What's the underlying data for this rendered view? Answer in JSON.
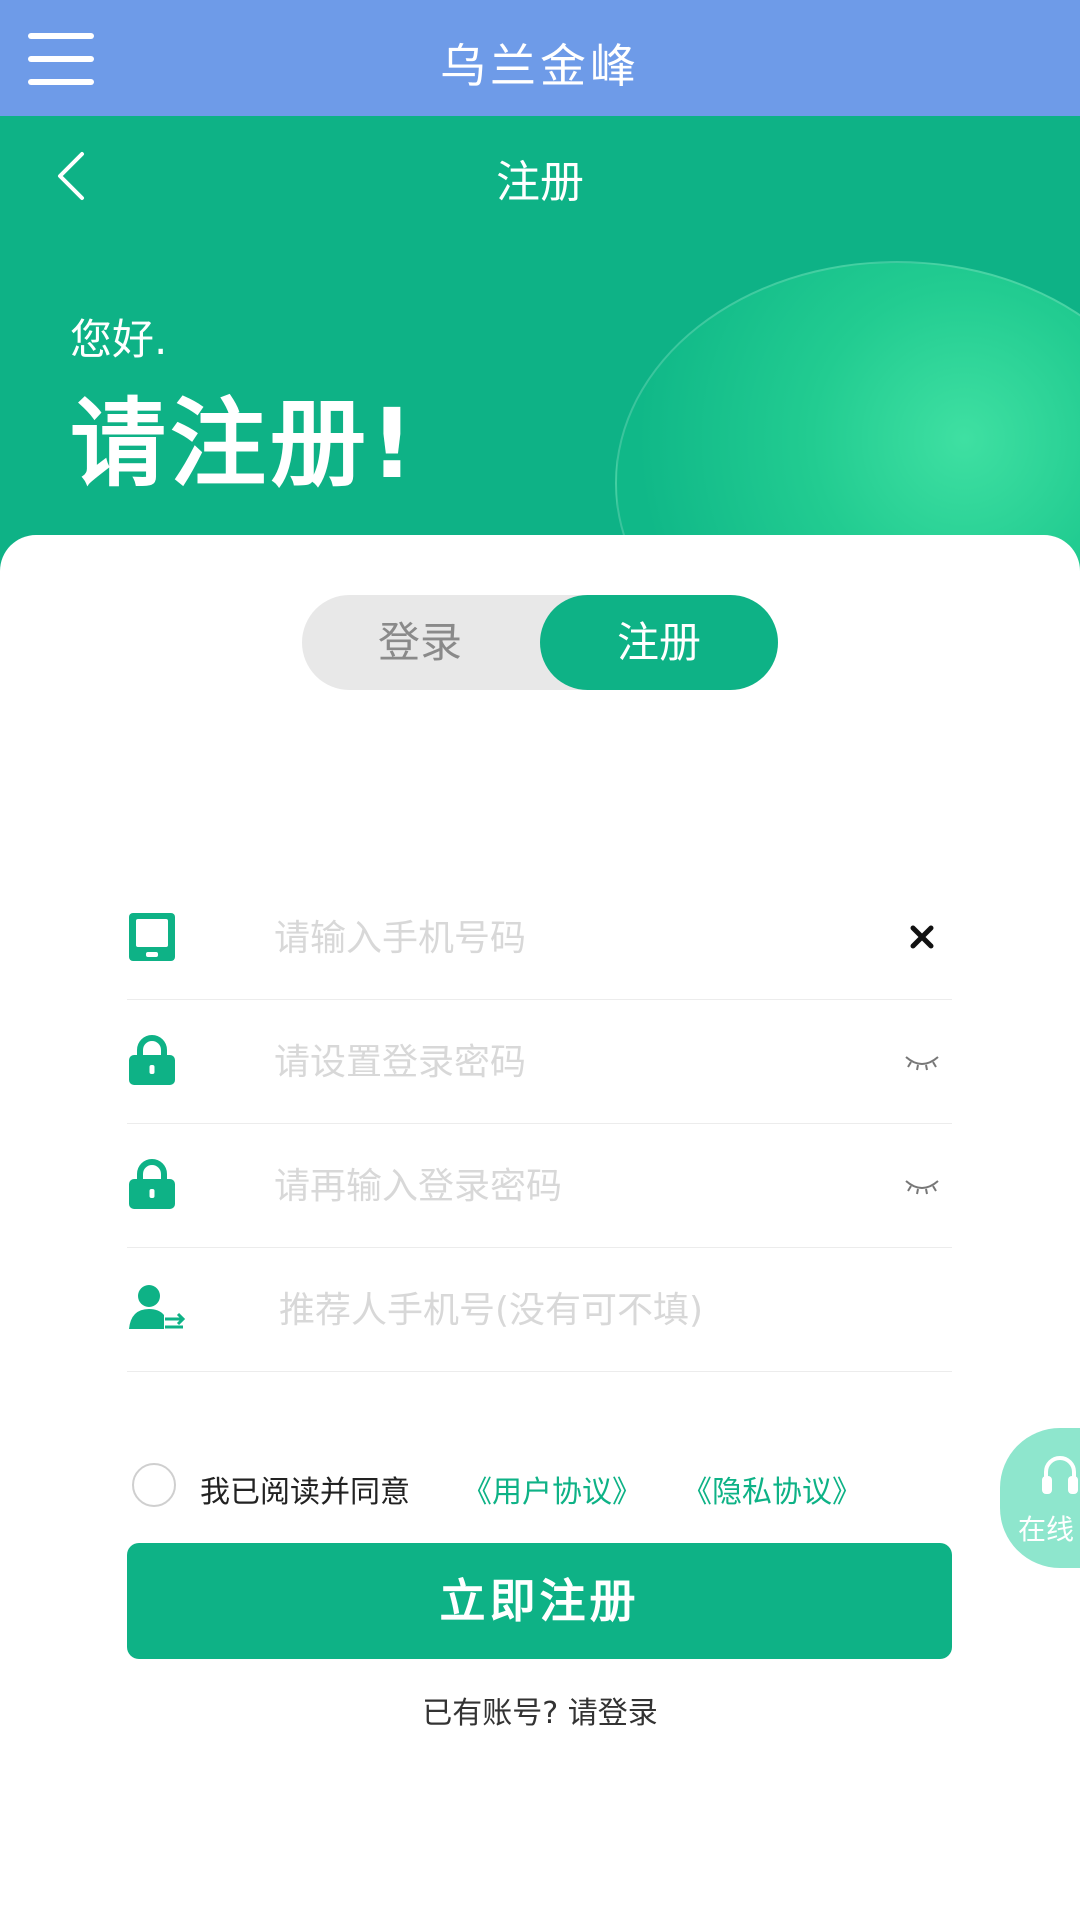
{
  "app": {
    "title": "乌兰金峰"
  },
  "nav": {
    "title": "注册"
  },
  "hero": {
    "greeting": "您好.",
    "headline": "请注册!"
  },
  "tabs": {
    "login": "登录",
    "register": "注册",
    "active": "register"
  },
  "form": {
    "phone": {
      "placeholder": "请输入手机号码",
      "value": ""
    },
    "password": {
      "placeholder": "请设置登录密码",
      "value": ""
    },
    "password_confirm": {
      "placeholder": "请再输入登录密码",
      "value": ""
    },
    "referrer": {
      "placeholder": "推荐人手机号(没有可不填)",
      "value": ""
    }
  },
  "agreement": {
    "text": "我已阅读并同意",
    "user_agreement": "《用户协议》",
    "privacy_policy": "《隐私协议》",
    "checked": false
  },
  "submit_label": "立即注册",
  "login_prompt": "已有账号? 请登录",
  "service": {
    "label": "在线"
  },
  "colors": {
    "accent": "#0eb286",
    "appbar": "#6e9be8"
  }
}
